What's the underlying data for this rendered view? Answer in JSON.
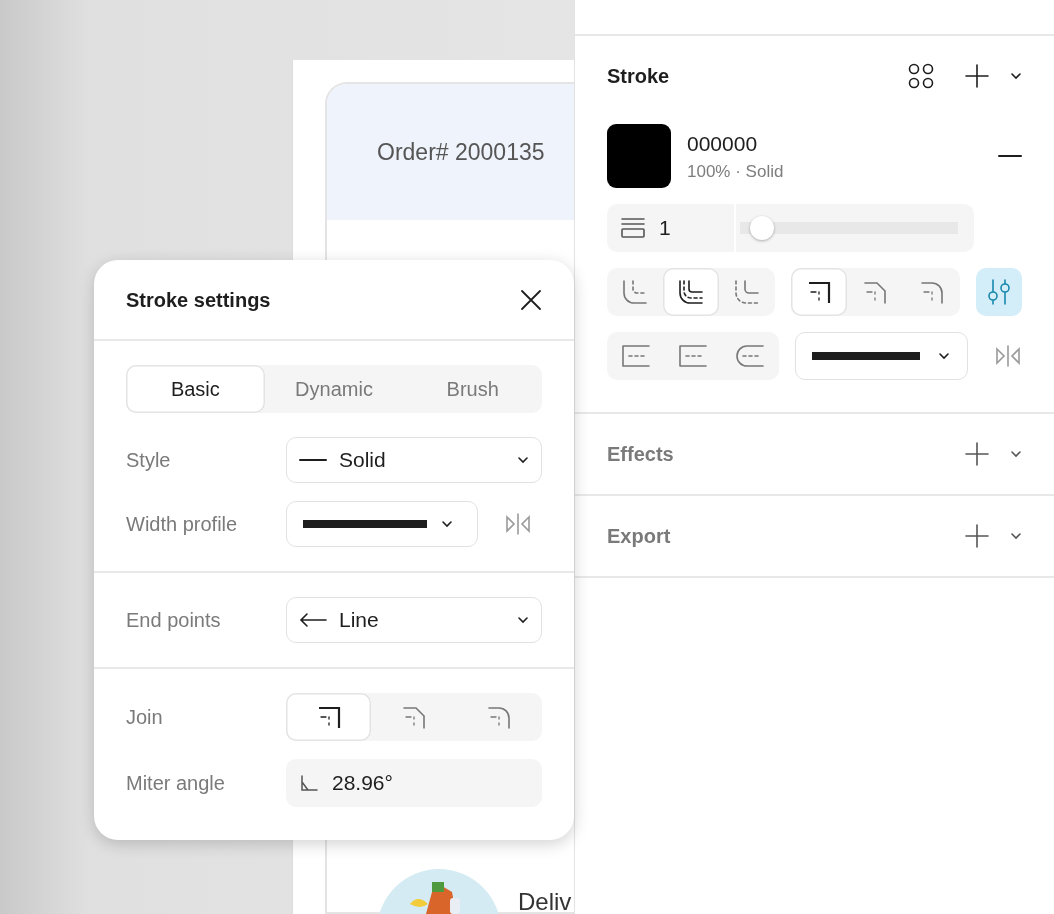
{
  "canvas": {
    "order_title": "Order# 2000135",
    "delivery_text": "Deliv"
  },
  "stroke_panel": {
    "title": "Stroke",
    "paint": {
      "color": "#000000",
      "hex": "000000",
      "detail": "100% · Solid"
    },
    "weight": "1",
    "level": 0.05,
    "position_options": [
      {
        "kind": "inside",
        "selected": false
      },
      {
        "kind": "center",
        "selected": true
      },
      {
        "kind": "outside",
        "selected": false
      }
    ],
    "join_options": [
      {
        "kind": "miter",
        "selected": true
      },
      {
        "kind": "bevel",
        "selected": false
      },
      {
        "kind": "round",
        "selected": false
      }
    ],
    "advanced_selected": true,
    "cap_options": [
      {
        "kind": "none",
        "selected": false
      },
      {
        "kind": "square",
        "selected": false
      },
      {
        "kind": "round",
        "selected": false
      }
    ]
  },
  "sections": [
    {
      "title": "Effects"
    },
    {
      "title": "Export"
    }
  ],
  "popover": {
    "title": "Stroke settings",
    "tabs": [
      {
        "label": "Basic",
        "selected": true
      },
      {
        "label": "Dynamic",
        "selected": false
      },
      {
        "label": "Brush",
        "selected": false
      }
    ],
    "groups": [
      [
        {
          "kind": "style",
          "label": "Style",
          "value": "Solid"
        },
        {
          "kind": "profile",
          "label": "Width profile"
        }
      ],
      [
        {
          "kind": "ends",
          "label": "End points",
          "value": "Line"
        }
      ],
      [
        {
          "kind": "join",
          "label": "Join",
          "options": [
            {
              "kind": "miter",
              "selected": true
            },
            {
              "kind": "bevel",
              "selected": false
            },
            {
              "kind": "round",
              "selected": false
            }
          ]
        },
        {
          "kind": "number",
          "label": "Miter angle",
          "value": "28.96°"
        }
      ]
    ]
  }
}
